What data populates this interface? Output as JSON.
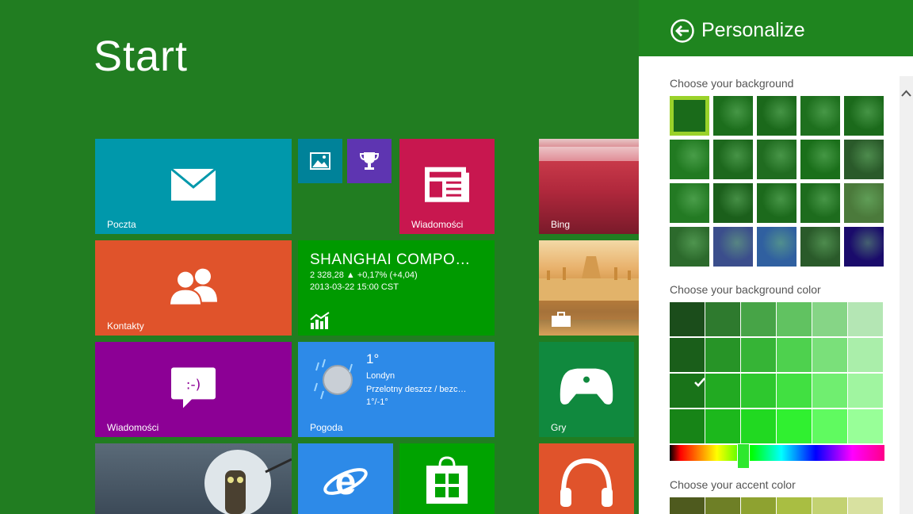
{
  "start": {
    "title": "Start",
    "tiles": {
      "mail": {
        "label": "Poczta",
        "color": "#0098ab"
      },
      "photos": {
        "label": "",
        "color": "#008299"
      },
      "trophy": {
        "label": "",
        "color": "#5e35b1"
      },
      "news": {
        "label": "Wiadomości",
        "color": "#c8174f"
      },
      "bing": {
        "label": "Bing"
      },
      "contacts": {
        "label": "Kontakty",
        "color": "#e0532b"
      },
      "finance": {
        "name": "SHANGHAI COMPO…",
        "line1": "2 328,28  ▲ +0,17% (+4,04)",
        "line2": "2013-03-22 15:00 CST",
        "color": "#009a00"
      },
      "messaging": {
        "label": "Wiadomości",
        "color": "#8c0095"
      },
      "weather": {
        "label": "Pogoda",
        "temp": "1°",
        "city": "Londyn",
        "desc": "Przelotny deszcz / bezc…",
        "range": "1°/-1°",
        "color": "#2d8ae8"
      },
      "games": {
        "label": "Gry",
        "color": "#10893e"
      },
      "desktop": {
        "label": ""
      },
      "ie": {
        "label": "",
        "color": "#2d8ae8"
      },
      "store": {
        "label": "",
        "color": "#00a300"
      },
      "music": {
        "label": "",
        "color": "#e0532b"
      }
    }
  },
  "panel": {
    "title": "Personalize",
    "background_label": "Choose your background",
    "background_color_label": "Choose your background color",
    "accent_label": "Choose your accent color",
    "backgrounds_row_colors": [
      [
        "#1a6b1a",
        "#1c6e1c",
        "#1b691b",
        "#1e701e",
        "#1b6a1b"
      ],
      [
        "#217a21",
        "#1d681d",
        "#206c20",
        "#1a6f1a",
        "#2a5a2a"
      ],
      [
        "#237a23",
        "#1b5f1b",
        "#1c6a1c",
        "#1d6c1d",
        "#4b7a3b"
      ],
      [
        "#2c6a2c",
        "#3b4e8c",
        "#3060a0",
        "#2a5a2a",
        "#1a0b6b"
      ]
    ],
    "background_colors": [
      [
        "#1b4d1b",
        "#2e7a2e",
        "#47a447",
        "#61c261",
        "#86d586",
        "#b4e6b4"
      ],
      [
        "#1a5e1a",
        "#279427",
        "#36b436",
        "#4ed14e",
        "#7ae07a",
        "#aaeeaa"
      ],
      [
        "#197319",
        "#22aa22",
        "#2ec82e",
        "#41e041",
        "#70ee70",
        "#a0f5a0"
      ],
      [
        "#178417",
        "#1cb81c",
        "#21d921",
        "#30f030",
        "#60fa60",
        "#98ff98"
      ]
    ],
    "accent_colors": [
      "#4e5a1e",
      "#6e7f26",
      "#8ea230",
      "#a9be42",
      "#c3d272",
      "#d8e1a0"
    ]
  }
}
